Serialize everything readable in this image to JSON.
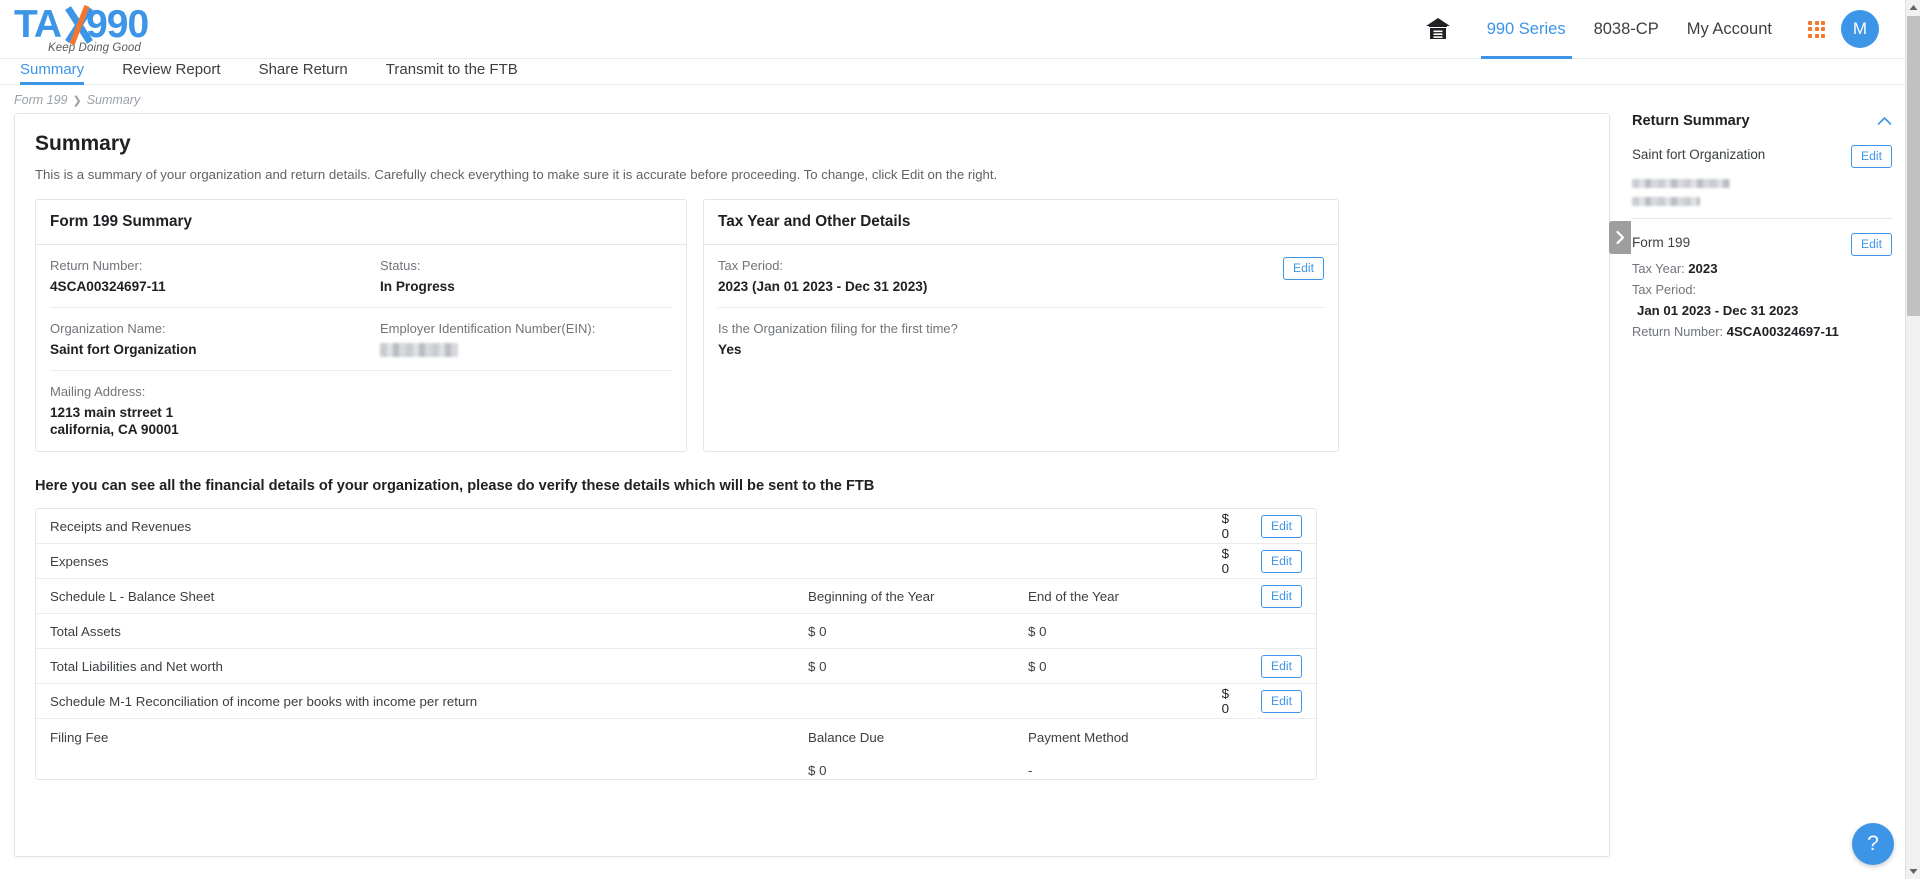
{
  "brand": {
    "logo_main": "TA",
    "logo_main_rest": "990",
    "tagline": "Keep Doing Good",
    "accent_blue": "#3d95e8",
    "accent_orange": "#f2762e"
  },
  "topnav": {
    "home_icon": "home-bank-icon",
    "links": [
      {
        "label": "990 Series",
        "active": true
      },
      {
        "label": "8038-CP",
        "active": false
      },
      {
        "label": "My Account",
        "active": false
      }
    ],
    "apps_icon": "apps-grid-icon",
    "avatar_initial": "M"
  },
  "tabs": [
    {
      "label": "Summary",
      "active": true
    },
    {
      "label": "Review Report",
      "active": false
    },
    {
      "label": "Share Return",
      "active": false
    },
    {
      "label": "Transmit to the FTB",
      "active": false
    }
  ],
  "breadcrumb": {
    "root": "Form 199",
    "separator": "❯",
    "current": "Summary"
  },
  "main": {
    "title": "Summary",
    "subtitle": "This is a summary of your organization and return details. Carefully check everything to make sure it is accurate before proceeding. To change, click Edit on the right.",
    "form_panel": {
      "heading": "Form 199 Summary",
      "return_number_label": "Return Number:",
      "return_number_value": "4SCA00324697-11",
      "status_label": "Status:",
      "status_value": "In Progress",
      "org_name_label": "Organization Name:",
      "org_name_value": "Saint fort Organization",
      "ein_label": "Employer Identification Number(EIN):",
      "ein_value": "",
      "mailing_label": "Mailing Address:",
      "mailing_line1": "1213 main strreet 1",
      "mailing_line2": "california, CA 90001"
    },
    "tax_panel": {
      "heading": "Tax Year and Other Details",
      "tax_period_label": "Tax Period:",
      "tax_period_value": "2023 (Jan 01 2023 - Dec 31 2023)",
      "first_time_label": "Is the Organization filing for the first time?",
      "first_time_value": "Yes",
      "edit_label": "Edit"
    },
    "financial": {
      "intro": "Here you can see all the financial details of your organization, please do verify these details which will be sent to the FTB",
      "edit_label": "Edit",
      "rows": [
        {
          "name": "Receipts and Revenues",
          "col1": "",
          "col2": "",
          "amount": "$ 0",
          "edit": true,
          "tall": false
        },
        {
          "name": "Expenses",
          "col1": "",
          "col2": "",
          "amount": "$ 0",
          "edit": true,
          "tall": false
        },
        {
          "name": "Schedule L - Balance Sheet",
          "col1": "Beginning of the Year",
          "col2": "End of the Year",
          "amount": "",
          "edit": true,
          "tall": false
        },
        {
          "name": "Total Assets",
          "col1": "$ 0",
          "col2": "$ 0",
          "amount": "",
          "edit": false,
          "tall": false
        },
        {
          "name": "Total Liabilities and Net worth",
          "col1": "$ 0",
          "col2": "$ 0",
          "amount": "",
          "edit": true,
          "tall": false
        },
        {
          "name": "Schedule M-1 Reconciliation of income per books with income per return",
          "col1": "",
          "col2": "",
          "amount": "$ 0",
          "edit": true,
          "tall": false
        },
        {
          "name": "Filing Fee",
          "col1": "Balance Due",
          "col2": "Payment Method",
          "col1_sub": "$ 0",
          "col2_sub": "-",
          "amount": "",
          "edit": false,
          "tall": true
        }
      ]
    }
  },
  "sidebar": {
    "title": "Return Summary",
    "collapse_icon": "chevron-up-icon",
    "edit_label": "Edit",
    "org_name": "Saint fort Organization",
    "form_name": "Form 199",
    "tax_year_label": "Tax Year:",
    "tax_year_value": "2023",
    "tax_period_label": "Tax Period:",
    "tax_period_value": "Jan 01 2023 - Dec 31 2023",
    "return_number_label": "Return Number:",
    "return_number_value": "4SCA00324697-11"
  },
  "side_toggle_icon": "chevron-right-icon",
  "help": {
    "label": "?"
  }
}
